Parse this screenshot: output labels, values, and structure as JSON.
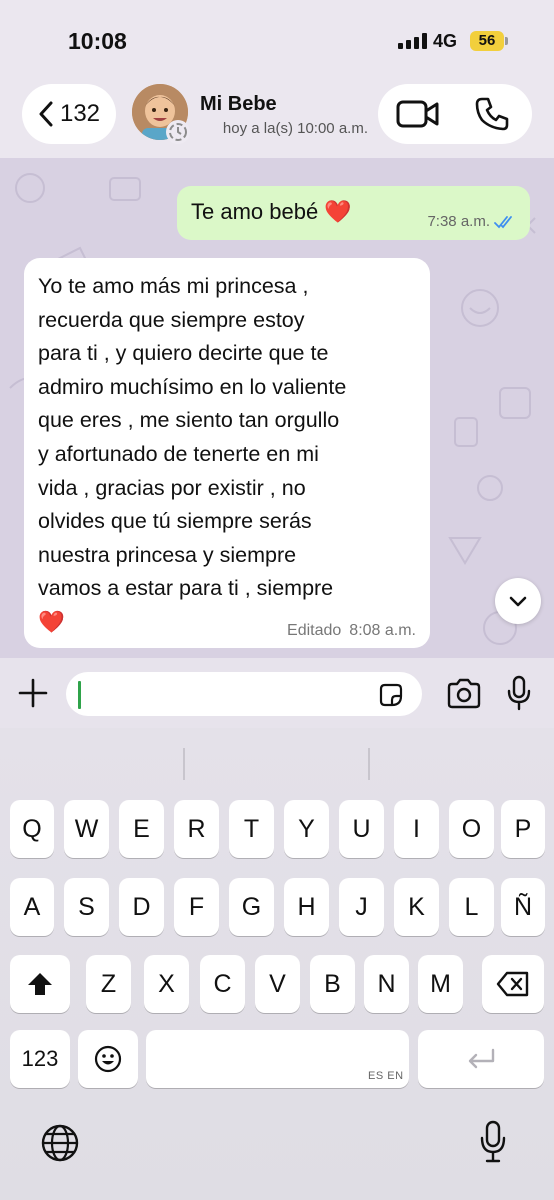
{
  "status_bar": {
    "time": "10:08",
    "network": "4G",
    "battery": "56",
    "battery_color": "#f2cf3c"
  },
  "header": {
    "back_count": "132",
    "contact_name": "Mi Bebe",
    "contact_status": "hoy a la(s) 10:00 a.m.",
    "icons": [
      "chevron-left-icon",
      "video-icon",
      "phone-icon"
    ]
  },
  "messages": {
    "outgoing": {
      "text": "Te amo bebé ❤️",
      "time": "7:38 a.m.",
      "status_icon": "double-check-icon",
      "bubble_color": "#dbf8c8"
    },
    "incoming": {
      "lines": [
        "Yo te amo más mi princesa  ,",
        "recuerda que siempre estoy",
        "para ti , y quiero decirte que te",
        "admiro muchísimo en lo valiente",
        "que eres , me siento tan orgullo",
        "y afortunado de tenerte en mi",
        "vida , gracias por existir , no",
        "olvides que tú siempre serás",
        "nuestra princesa y siempre",
        "vamos a estar para ti , siempre",
        "❤️"
      ],
      "edited_label": "Editado",
      "time": "8:08 a.m."
    }
  },
  "input": {
    "value": "",
    "icons": [
      "plus-icon",
      "sticker-icon",
      "camera-icon",
      "mic-icon"
    ]
  },
  "keyboard": {
    "row1": [
      "Q",
      "W",
      "E",
      "R",
      "T",
      "Y",
      "U",
      "I",
      "O",
      "P"
    ],
    "row2": [
      "A",
      "S",
      "D",
      "F",
      "G",
      "H",
      "J",
      "K",
      "L",
      "Ñ"
    ],
    "row3": [
      "Z",
      "X",
      "C",
      "V",
      "B",
      "N",
      "M"
    ],
    "numbers_key": "123",
    "space_languages": "ES EN",
    "icons": [
      "shift-icon",
      "backspace-icon",
      "emoji-icon",
      "return-icon",
      "globe-icon",
      "dictation-mic-icon"
    ]
  }
}
